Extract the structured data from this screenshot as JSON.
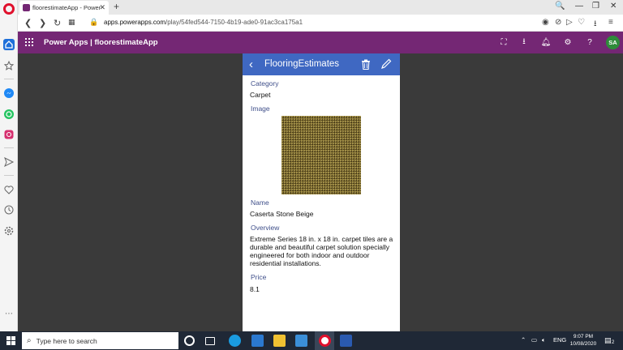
{
  "browser": {
    "tab_title": "floorestimateApp - Power",
    "tab_close": "✕",
    "new_tab": "+",
    "window_controls": [
      "🔍",
      "—",
      "❐",
      "✕"
    ],
    "url_host": "apps.powerapps.com",
    "url_path": "/play/54fed544-7150-4b19-ade0-91ac3ca175a1"
  },
  "powerapps": {
    "title": "Power Apps  |  floorestimateApp",
    "avatar_initials": "SA",
    "header_icons": [
      "fit-screen-icon",
      "download-icon",
      "bell-icon",
      "gear-icon",
      "help-icon"
    ]
  },
  "app": {
    "title": "FlooringEstimates",
    "fields": {
      "category_label": "Category",
      "category_value": "Carpet",
      "image_label": "Image",
      "name_label": "Name",
      "name_value": "Caserta Stone Beige",
      "overview_label": "Overview",
      "overview_value": "Extreme Series 18 in. x 18 in. carpet tiles are a durable and beautiful carpet solution specially engineered for both indoor and outdoor residential installations.",
      "price_label": "Price",
      "price_value": "8.1"
    }
  },
  "taskbar": {
    "search_placeholder": "Type here to search",
    "language": "ENG",
    "time": "9:07 PM",
    "date": "10/08/2020",
    "notification_count": "2"
  },
  "colors": {
    "powerapps_purple": "#742774",
    "app_header_blue": "#3f68c2",
    "stage_dark": "#3a3a3a",
    "taskbar": "#1f2836"
  }
}
